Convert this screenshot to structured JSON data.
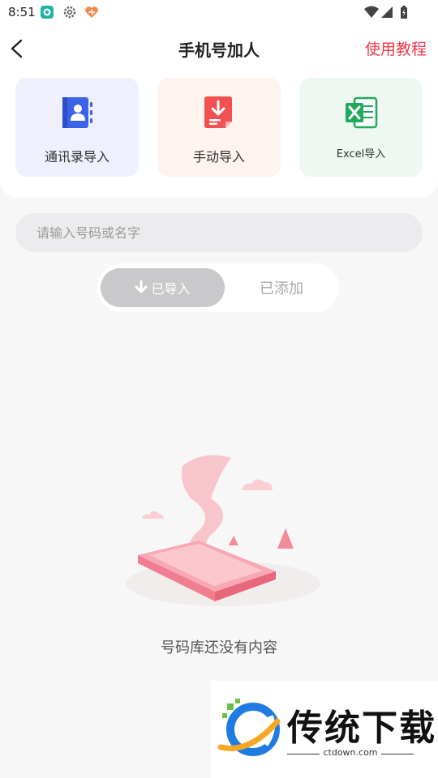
{
  "status_bar": {
    "time": "8:51"
  },
  "header": {
    "title": "手机号加人",
    "tutorial_label": "使用教程"
  },
  "import_options": [
    {
      "label": "通讯录导入",
      "icon": "contacts-book-icon"
    },
    {
      "label": "手动导入",
      "icon": "manual-import-icon"
    },
    {
      "label": "Excel导入",
      "icon": "excel-icon"
    }
  ],
  "search": {
    "placeholder": "请输入号码或名字",
    "value": ""
  },
  "tabs": {
    "imported_label": "已导入",
    "added_label": "已添加",
    "selected": "imported"
  },
  "empty_state": {
    "message": "号码库还没有内容"
  },
  "watermark": {
    "name": "传统下载",
    "domain": "ctdown.com"
  },
  "colors": {
    "accent_red": "#f0394a",
    "contacts_blue": "#3b63e8",
    "manual_red": "#f25151",
    "excel_green": "#21a85a"
  }
}
